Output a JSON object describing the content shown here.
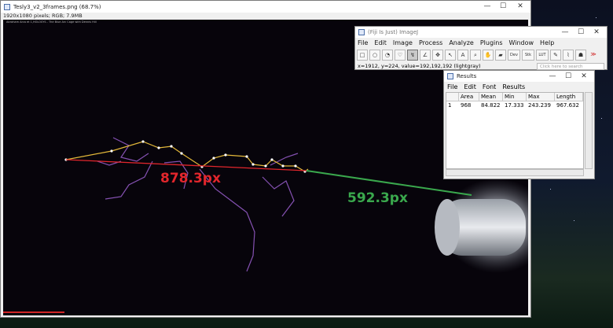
{
  "image_window": {
    "title": "Tesly3_v2_3frames.png (68.7%)",
    "info": "1920x1080 pixels; RGB; 7.9MB",
    "video_title": "Abraham Arca et 1,HOLOSYS - The Blue Arc Cage with Dennis Hill"
  },
  "annotations": {
    "red_measure": "878.3px",
    "green_measure": "592.3px",
    "red_color": "#e2262c",
    "green_color": "#3aa84d"
  },
  "fiji": {
    "title": "(Fiji Is Just) ImageJ",
    "menu": [
      "File",
      "Edit",
      "Image",
      "Process",
      "Analyze",
      "Plugins",
      "Window",
      "Help"
    ],
    "tools": [
      "□",
      "○",
      "◔",
      "♡",
      "↯",
      "∠",
      "✥",
      "↖",
      "A",
      "⌕",
      "✋",
      "▰",
      "Dev",
      "Stk",
      "LUT",
      "✎",
      "⌇",
      "☗",
      "≫"
    ],
    "status": "x=1912, y=224, value=192,192,192 (lightgray)",
    "search_placeholder": "Click here to search"
  },
  "results": {
    "title": "Results",
    "menu": [
      "File",
      "Edit",
      "Font",
      "Results"
    ],
    "columns": [
      "",
      "Area",
      "Mean",
      "Min",
      "Max",
      "Length"
    ],
    "rows": [
      [
        "1",
        "968",
        "84.822",
        "17.333",
        "243.239",
        "967.632"
      ]
    ]
  }
}
